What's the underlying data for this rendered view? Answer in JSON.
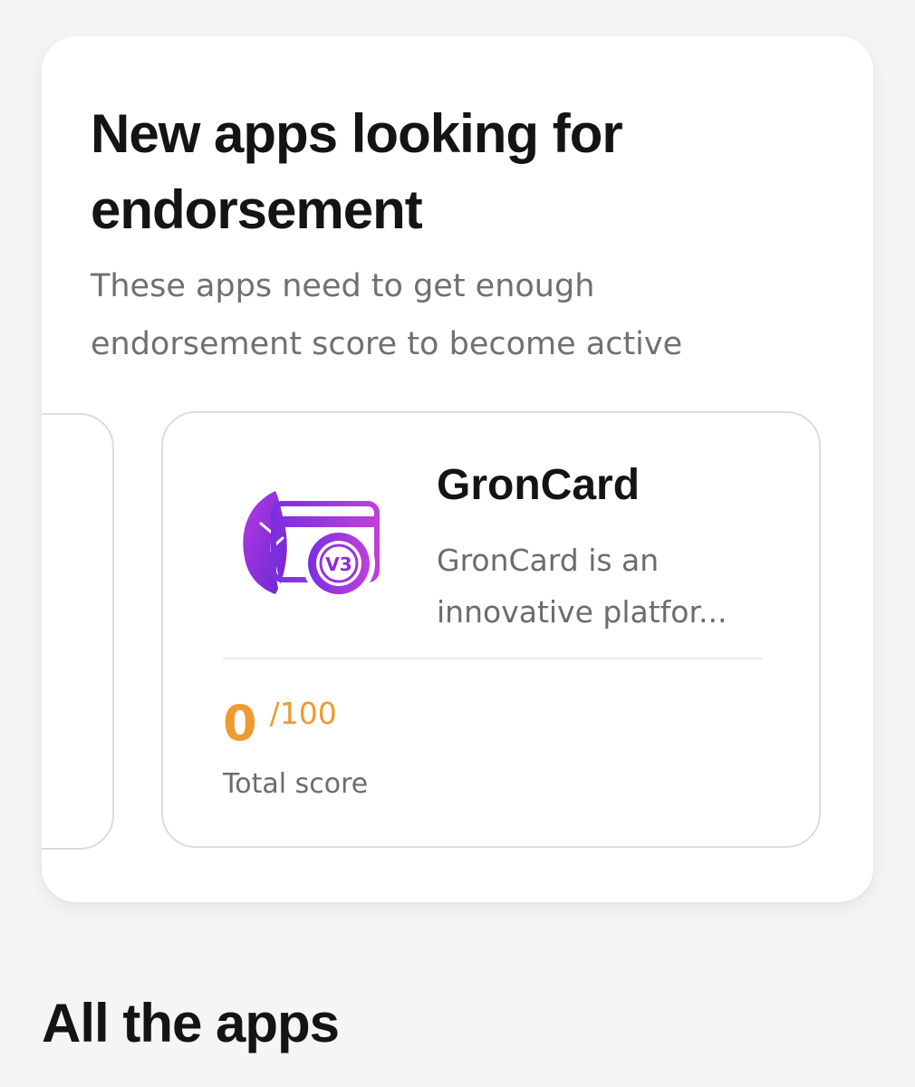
{
  "endorsement_section": {
    "title": "New apps looking for endorsement",
    "subtitle": "These apps need to get enough endorsement score to become active"
  },
  "app_card": {
    "name": "GronCard",
    "description": "GronCard is an innovative platfor...",
    "score_value": "0",
    "score_max": "/100",
    "score_label": "Total score",
    "logo_icon": "groncard-logo-icon",
    "logo_badge_text": "V3"
  },
  "all_apps_section": {
    "title": "All the apps"
  },
  "colors": {
    "score_accent": "#f09a30",
    "logo_purple": "#8a2be2",
    "logo_violet": "#b23be0",
    "card_border": "#dcdcdc",
    "page_background": "#f5f5f5"
  }
}
